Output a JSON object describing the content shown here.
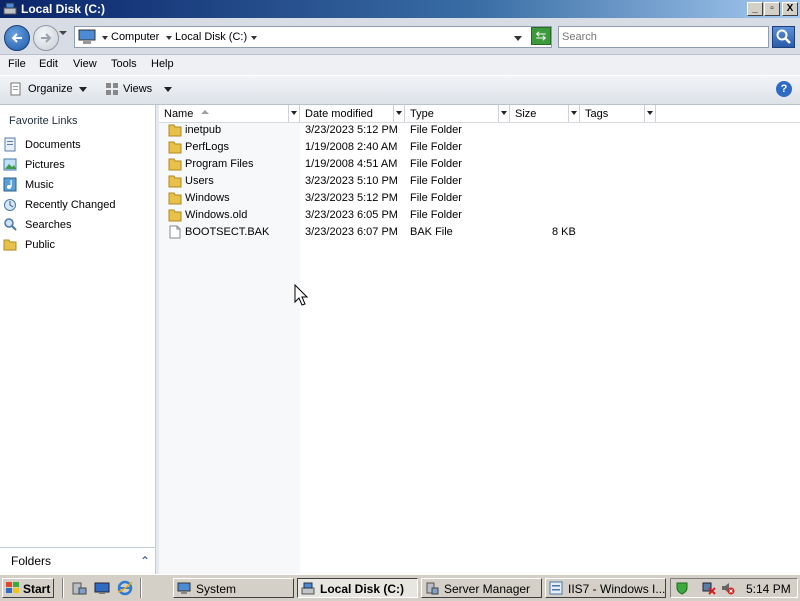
{
  "window": {
    "title": "Local Disk (C:)",
    "controls": [
      "_",
      "▫",
      "X"
    ]
  },
  "address": {
    "crumbs": [
      "Computer",
      "Local Disk (C:)"
    ],
    "search_placeholder": "Search"
  },
  "menu": [
    "File",
    "Edit",
    "View",
    "Tools",
    "Help"
  ],
  "commands": {
    "organize": "Organize",
    "views": "Views"
  },
  "nav": {
    "header": "Favorite Links",
    "items": [
      {
        "label": "Documents",
        "icon": "documents-icon"
      },
      {
        "label": "Pictures",
        "icon": "pictures-icon"
      },
      {
        "label": "Music",
        "icon": "music-icon"
      },
      {
        "label": "Recently Changed",
        "icon": "recent-icon"
      },
      {
        "label": "Searches",
        "icon": "searches-icon"
      },
      {
        "label": "Public",
        "icon": "folder-icon"
      }
    ],
    "folders_label": "Folders",
    "folders_chevron": "⌃"
  },
  "columns": [
    "Name",
    "Date modified",
    "Type",
    "Size",
    "Tags"
  ],
  "files": [
    {
      "name": "inetpub",
      "date": "3/23/2023 5:12 PM",
      "type": "File Folder",
      "size": "",
      "kind": "folder"
    },
    {
      "name": "PerfLogs",
      "date": "1/19/2008 2:40 AM",
      "type": "File Folder",
      "size": "",
      "kind": "folder"
    },
    {
      "name": "Program Files",
      "date": "1/19/2008 4:51 AM",
      "type": "File Folder",
      "size": "",
      "kind": "folder"
    },
    {
      "name": "Users",
      "date": "3/23/2023 5:10 PM",
      "type": "File Folder",
      "size": "",
      "kind": "folder"
    },
    {
      "name": "Windows",
      "date": "3/23/2023 5:12 PM",
      "type": "File Folder",
      "size": "",
      "kind": "folder"
    },
    {
      "name": "Windows.old",
      "date": "3/23/2023 6:05 PM",
      "type": "File Folder",
      "size": "",
      "kind": "folder"
    },
    {
      "name": "BOOTSECT.BAK",
      "date": "3/23/2023 6:07 PM",
      "type": "BAK File",
      "size": "8 KB",
      "kind": "file"
    }
  ],
  "taskbar": {
    "start": "Start",
    "tasks": [
      {
        "label": "System",
        "active": false
      },
      {
        "label": "Local Disk (C:)",
        "active": true
      },
      {
        "label": "Server Manager",
        "active": false
      },
      {
        "label": "IIS7 - Windows I...",
        "active": false
      }
    ],
    "clock": "5:14 PM"
  },
  "colors": {
    "folder": "#e8c14a",
    "accent": "#2f6bc2"
  }
}
